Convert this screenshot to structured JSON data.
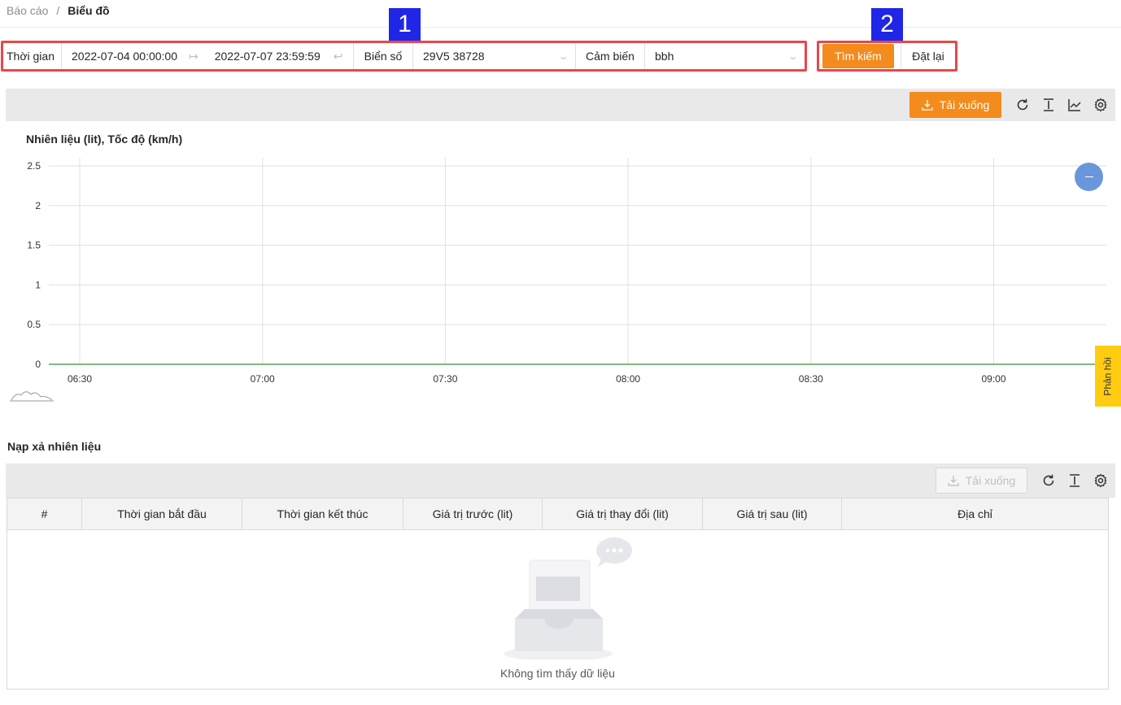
{
  "breadcrumb": {
    "parent": "Báo cáo",
    "separator": "/",
    "current": "Biểu đồ"
  },
  "callouts": {
    "one": "1",
    "two": "2"
  },
  "filter": {
    "time_label": "Thời gian",
    "start_date": "2022-07-04 00:00:00",
    "end_date": "2022-07-07 23:59:59",
    "plate_label": "Biển số",
    "plate_value": "29V5 38728",
    "sensor_label": "Cảm biến",
    "sensor_value": "bbh"
  },
  "actions": {
    "search_label": "Tìm kiếm",
    "reset_label": "Đặt lại"
  },
  "chart_toolbar": {
    "download_label": "Tải xuống"
  },
  "chart_data": {
    "type": "line",
    "title": "Nhiên liệu (lit), Tốc độ (km/h)",
    "x": [
      "06:30",
      "07:00",
      "07:30",
      "08:00",
      "08:30",
      "09:00"
    ],
    "yticks": [
      "0",
      "0.5",
      "1",
      "1.5",
      "2",
      "2.5"
    ],
    "ylim": [
      0,
      2.5
    ],
    "series": [
      {
        "values": [
          0,
          0,
          0,
          0,
          0,
          0
        ],
        "color": "#3a8f3a"
      }
    ],
    "grid": true
  },
  "feedback_label": "Phản hồi",
  "table_section": {
    "title": "Nạp xả nhiên liệu",
    "download_label": "Tải xuống",
    "columns": [
      "#",
      "Thời gian bắt đầu",
      "Thời gian kết thúc",
      "Giá trị trước (lit)",
      "Giá trị thay đổi (lit)",
      "Giá trị sau (lit)",
      "Địa chỉ"
    ],
    "empty_text": "Không tìm thấy dữ liệu"
  },
  "colors": {
    "accent": "#f38b1d",
    "highlight_border": "#e8474a",
    "callout": "#1f26e6",
    "feedback": "#ffcc12"
  }
}
